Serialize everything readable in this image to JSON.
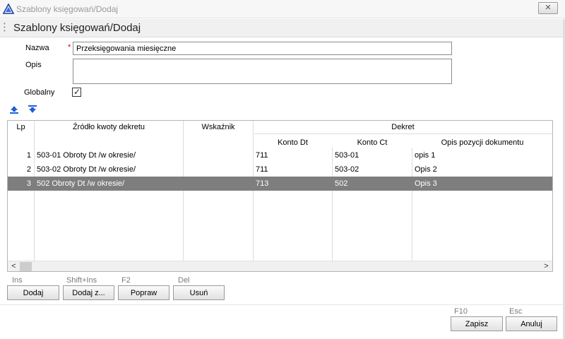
{
  "window": {
    "title": "Szablony księgowań/Dodaj",
    "close_label": "✕"
  },
  "header": {
    "title": "Szablony księgowań/Dodaj"
  },
  "form": {
    "nazwa_label": "Nazwa",
    "required_mark": "*",
    "nazwa_value": "Przeksięgowania miesięczne",
    "opis_label": "Opis",
    "opis_value": "",
    "globalny_label": "Globalny",
    "globalny_checked": true,
    "check_glyph": "✓"
  },
  "toolbar": {
    "icons": [
      "move-up-icon",
      "move-down-icon"
    ]
  },
  "grid": {
    "headers": {
      "lp": "Lp",
      "zrodlo": "Źródło kwoty dekretu",
      "wskaznik": "Wskaźnik",
      "dekret": "Dekret",
      "konto_dt": "Konto Dt",
      "konto_ct": "Konto Ct",
      "opis_pozycji": "Opis pozycji dokumentu"
    },
    "rows": [
      {
        "lp": "1",
        "zrodlo": "503-01 Obroty Dt /w okresie/",
        "wskaznik": "",
        "konto_dt": "711",
        "konto_ct": "503-01",
        "opis": "opis 1",
        "selected": false
      },
      {
        "lp": "2",
        "zrodlo": "503-02 Obroty Dt /w okresie/",
        "wskaznik": "",
        "konto_dt": "711",
        "konto_ct": "503-02",
        "opis": "Opis 2",
        "selected": false
      },
      {
        "lp": "3",
        "zrodlo": "502 Obroty Dt /w okresie/",
        "wskaznik": "",
        "konto_dt": "713",
        "konto_ct": "502",
        "opis": "Opis 3",
        "selected": true
      }
    ],
    "scroll_left_glyph": "<",
    "scroll_right_glyph": ">"
  },
  "actions": {
    "dodaj": {
      "shortcut": "Ins",
      "label": "Dodaj"
    },
    "dodaj_z": {
      "shortcut": "Shift+Ins",
      "label": "Dodaj z..."
    },
    "popraw": {
      "shortcut": "F2",
      "label": "Popraw"
    },
    "usun": {
      "shortcut": "Del",
      "label": "Usuń"
    }
  },
  "footer": {
    "zapisz": {
      "shortcut": "F10",
      "label": "Zapisz"
    },
    "anuluj": {
      "shortcut": "Esc",
      "label": "Anuluj"
    }
  },
  "colors": {
    "selected_row": "#7e7e7e",
    "required": "#d00000",
    "accent": "#1f5fd6"
  }
}
